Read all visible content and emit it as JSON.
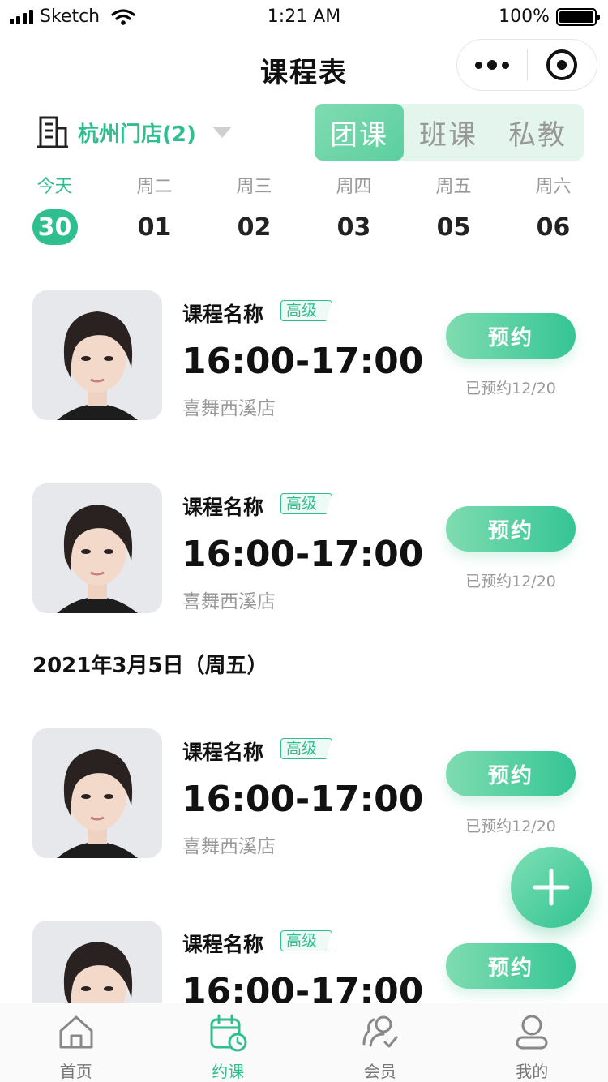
{
  "status_bar": {
    "carrier": "Sketch",
    "time": "1:21 AM",
    "battery": "100%"
  },
  "nav": {
    "title": "课程表"
  },
  "store": {
    "name": "杭州门店(2)"
  },
  "segment_tabs": [
    {
      "label": "团课",
      "active": true
    },
    {
      "label": "班课",
      "active": false
    },
    {
      "label": "私教",
      "active": false
    }
  ],
  "week": [
    {
      "label": "今天",
      "date": "30",
      "today": true
    },
    {
      "label": "周二",
      "date": "01",
      "today": false
    },
    {
      "label": "周三",
      "date": "02",
      "today": false
    },
    {
      "label": "周四",
      "date": "03",
      "today": false
    },
    {
      "label": "周五",
      "date": "05",
      "today": false
    },
    {
      "label": "周六",
      "date": "06",
      "today": false
    }
  ],
  "courses": [
    {
      "name": "课程名称",
      "level": "高级",
      "time": "16:00-17:00",
      "store": "喜舞西溪店",
      "button": "预约",
      "booked": "已预约12/20"
    },
    {
      "name": "课程名称",
      "level": "高级",
      "time": "16:00-17:00",
      "store": "喜舞西溪店",
      "button": "预约",
      "booked": "已预约12/20"
    },
    {
      "name": "课程名称",
      "level": "高级",
      "time": "16:00-17:00",
      "store": "喜舞西溪店",
      "button": "预约",
      "booked": "已预约12/20"
    },
    {
      "name": "课程名称",
      "level": "高级",
      "time": "16:00-17:00",
      "store": "",
      "button": "预约",
      "booked": ""
    }
  ],
  "date_header": "2021年3月5日（周五）",
  "tabbar": [
    {
      "label": "首页",
      "icon": "home-icon",
      "active": false
    },
    {
      "label": "约课",
      "icon": "calendar-clock-icon",
      "active": true
    },
    {
      "label": "会员",
      "icon": "members-icon",
      "active": false
    },
    {
      "label": "我的",
      "icon": "profile-icon",
      "active": false
    }
  ],
  "colors": {
    "accent": "#2fbf8f",
    "accent_light": "#e4f5ee",
    "muted": "#999999"
  }
}
